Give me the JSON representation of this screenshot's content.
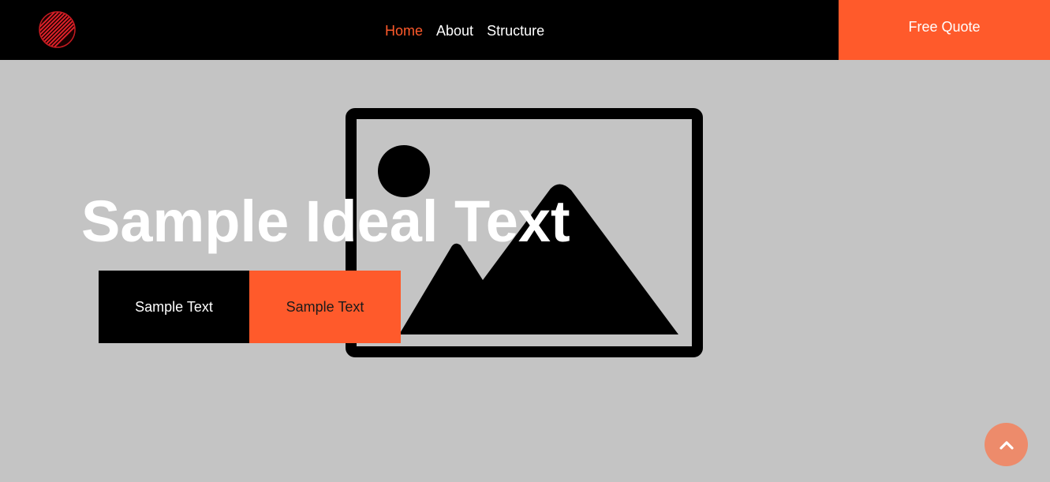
{
  "header": {
    "logo_icon": "striped-circle-logo-icon",
    "nav": [
      {
        "label": "Home",
        "active": true
      },
      {
        "label": "About",
        "active": false
      },
      {
        "label": "Structure",
        "active": false
      }
    ],
    "cta_label": "Free Quote"
  },
  "hero": {
    "image_icon": "image-placeholder-icon",
    "title": "Sample Ideal Text",
    "primary_button": "Sample Text",
    "secondary_button": "Sample Text"
  },
  "scroll_top_icon": "chevron-up-icon",
  "colors": {
    "header_bg": "#000000",
    "accent": "#ff5a2b",
    "page_bg": "#c4c4c4",
    "scroll_button": "#ed8b6b"
  }
}
